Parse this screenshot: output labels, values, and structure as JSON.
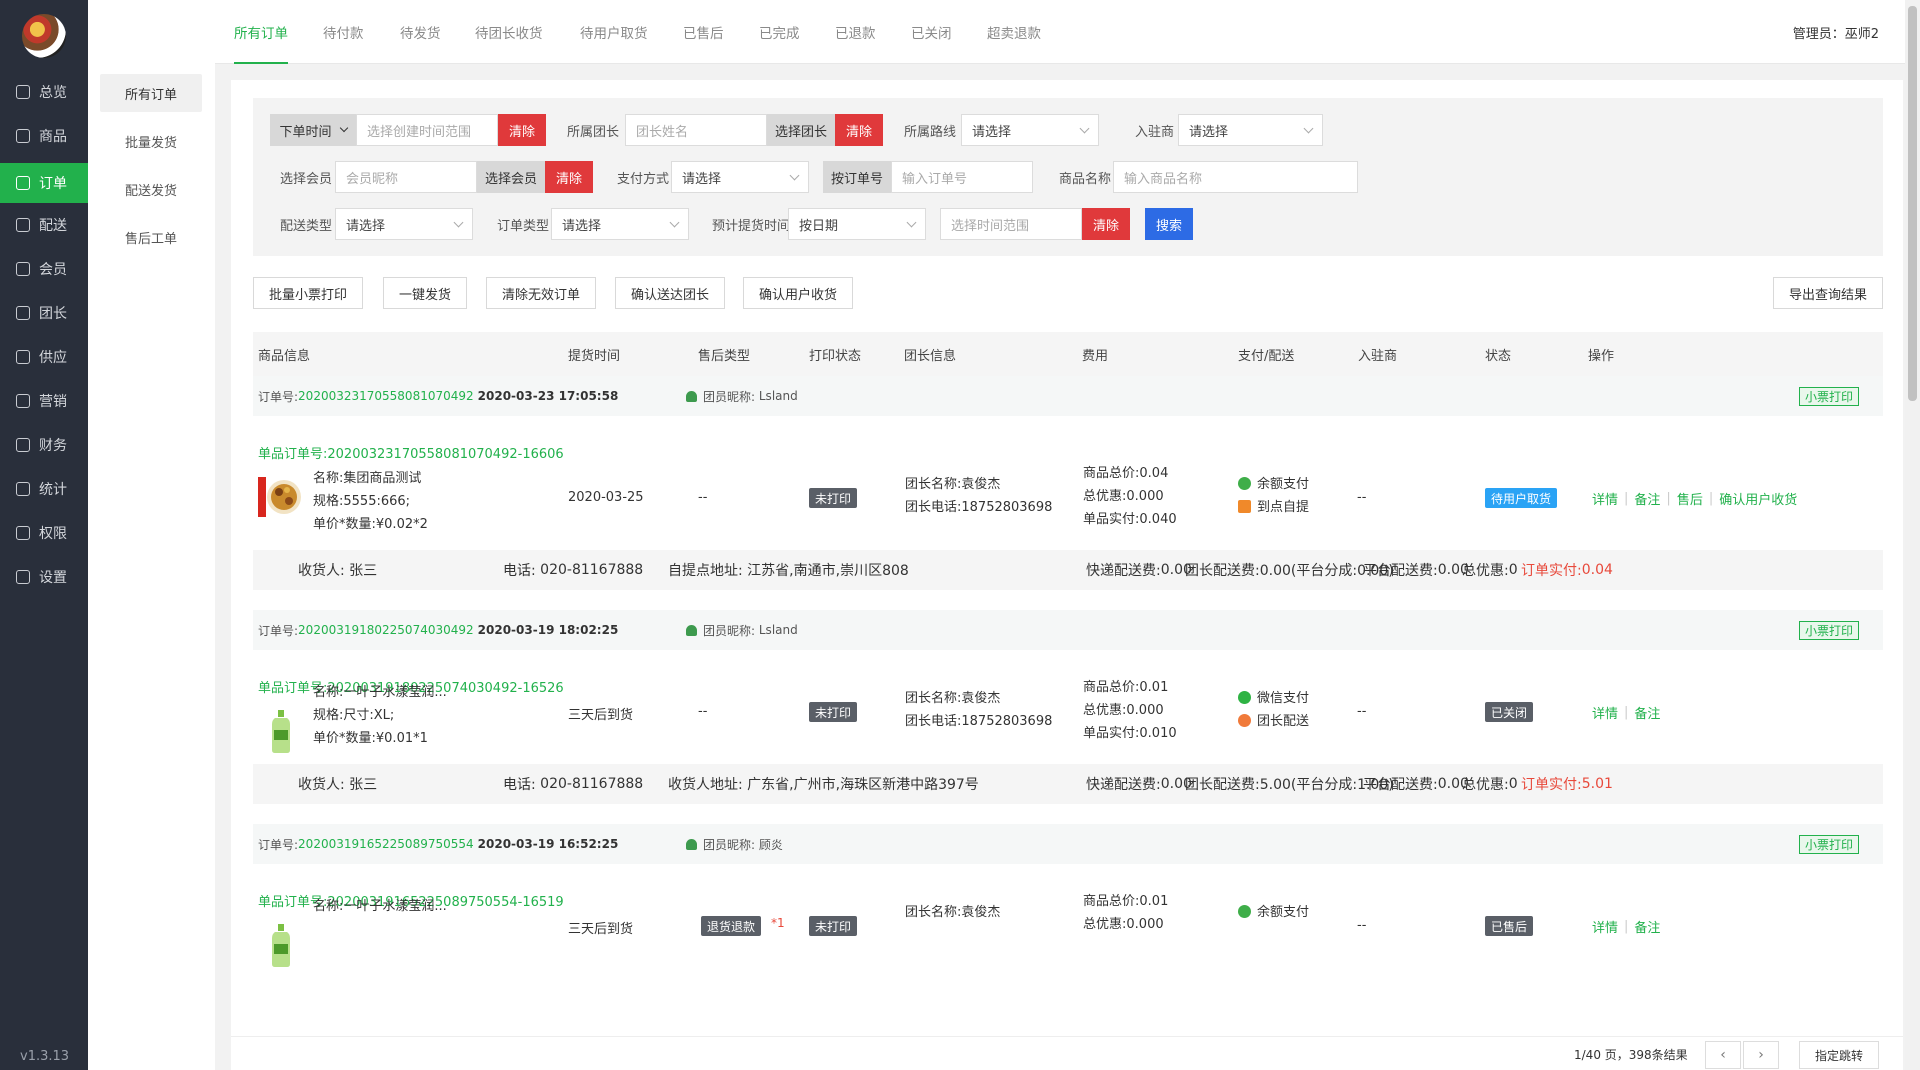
{
  "sidebar": {
    "version": "v1.3.13",
    "items": [
      {
        "label": "总览",
        "icon": "home-icon"
      },
      {
        "label": "商品",
        "icon": "box-icon"
      },
      {
        "label": "订单",
        "icon": "order-icon"
      },
      {
        "label": "配送",
        "icon": "truck-icon"
      },
      {
        "label": "会员",
        "icon": "user-icon"
      },
      {
        "label": "团长",
        "icon": "team-icon"
      },
      {
        "label": "供应",
        "icon": "supply-icon"
      },
      {
        "label": "营销",
        "icon": "gift-icon"
      },
      {
        "label": "财务",
        "icon": "finance-icon"
      },
      {
        "label": "统计",
        "icon": "chart-icon"
      },
      {
        "label": "权限",
        "icon": "shield-icon"
      },
      {
        "label": "设置",
        "icon": "gear-icon"
      }
    ]
  },
  "subnav": [
    "所有订单",
    "批量发货",
    "配送发货",
    "售后工单"
  ],
  "tabs": [
    "所有订单",
    "待付款",
    "待发货",
    "待团长收货",
    "待用户取货",
    "已售后",
    "已完成",
    "已退款",
    "已关闭",
    "超卖退款"
  ],
  "admin": {
    "label": "管理员：",
    "name": "巫师2"
  },
  "filters": {
    "order_time": "下单时间",
    "order_time_placeholder": "选择创建时间范围",
    "clear": "清除",
    "leader_label": "所属团长",
    "leader_placeholder": "团长姓名",
    "choose_leader": "选择团长",
    "route_label": "所属路线",
    "route_value": "请选择",
    "merchant_label": "入驻商",
    "merchant_value": "请选择",
    "member_label": "选择会员",
    "member_placeholder": "会员昵称",
    "choose_member": "选择会员",
    "pay_label": "支付方式",
    "pay_value": "请选择",
    "order_no_btn": "按订单号",
    "order_no_placeholder": "输入订单号",
    "goods_label": "商品名称",
    "goods_placeholder": "输入商品名称",
    "delivery_label": "配送类型",
    "delivery_value": "请选择",
    "ordertype_label": "订单类型",
    "ordertype_value": "请选择",
    "pickup_label": "预计提货时间",
    "pickup_value": "按日期",
    "pickup_placeholder": "选择时间范围",
    "search": "搜索"
  },
  "actions": [
    "批量小票打印",
    "一键发货",
    "清除无效订单",
    "确认送达团长",
    "确认用户收货"
  ],
  "export": "导出查询结果",
  "columns": [
    "商品信息",
    "提货时间",
    "售后类型",
    "打印状态",
    "团长信息",
    "费用",
    "支付/配送",
    "入驻商",
    "状态",
    "操作"
  ],
  "labels": {
    "order_no": "订单号:",
    "member": "团员昵称:",
    "ticket": "小票打印",
    "sub_order": "单品订单号:",
    "name": "名称:",
    "spec": "规格:",
    "unit": "单价*数量:",
    "leader_name": "团长名称:",
    "leader_phone": "团长电话:",
    "goods_total": "商品总价:",
    "total_discount": "总优惠:",
    "goods_paid": "单品实付:",
    "receiver": "收货人:",
    "phone": "电话:",
    "express_fee": "快递配送费:",
    "leader_fee": "团长配送费:",
    "platform_fee": "平台配送费:",
    "discount_total": "总优惠:",
    "order_paid": "订单实付:"
  },
  "orders": [
    {
      "order_no": "20200323170558081070492",
      "datetime": "2020-03-23 17:05:58",
      "member": "Lsland",
      "sub_no": "20200323170558081070492-16606",
      "name": "集团商品测试",
      "spec": "5555:666;",
      "unit": "¥0.02*2",
      "pickup": "2020-03-25",
      "aftersale": "--",
      "aftersale_badge": "",
      "aftersale_count": "",
      "print": "未打印",
      "leader_name": "袁俊杰",
      "leader_phone": "18752803698",
      "goods_total": "0.04",
      "discount": "0.000",
      "goods_paid": "0.040",
      "pay": "余额支付",
      "delivery": "到点自提",
      "merchant": "--",
      "status": "待用户取货",
      "status_style": "blue",
      "ops": [
        "详情",
        "备注",
        "售后",
        "确认用户收货"
      ],
      "receiver": "张三",
      "phone": "020-81167888",
      "address_label": "自提点地址:",
      "address": "江苏省,南通市,崇川区808",
      "express_fee": "0.00",
      "leader_fee": "0.00(平台分成:0.00)",
      "platform_fee": "0.00",
      "discount_total": "0",
      "order_paid": "0.04",
      "thumb": "food"
    },
    {
      "order_no": "20200319180225074030492",
      "datetime": "2020-03-19 18:02:25",
      "member": "Lsland",
      "sub_no": "20200319180225074030492-16526",
      "name": "一叶子水漾莹润...",
      "spec": "尺寸:XL;",
      "unit": "¥0.01*1",
      "pickup": "三天后到货",
      "aftersale": "--",
      "aftersale_badge": "",
      "aftersale_count": "",
      "print": "未打印",
      "leader_name": "袁俊杰",
      "leader_phone": "18752803698",
      "goods_total": "0.01",
      "discount": "0.000",
      "goods_paid": "0.010",
      "pay": "微信支付",
      "delivery": "团长配送",
      "merchant": "--",
      "status": "已关闭",
      "status_style": "dark",
      "ops": [
        "详情",
        "备注"
      ],
      "receiver": "张三",
      "phone": "020-81167888",
      "address_label": "收货人地址:",
      "address": "广东省,广州市,海珠区新港中路397号",
      "express_fee": "0.00",
      "leader_fee": "5.00(平台分成:1.00)",
      "platform_fee": "0.00",
      "discount_total": "0",
      "order_paid": "5.01",
      "thumb": "bottle"
    },
    {
      "order_no": "20200319165225089750554",
      "datetime": "2020-03-19 16:52:25",
      "member": "顾炎",
      "sub_no": "20200319165225089750554-16519",
      "name": "一叶子水漾莹润...",
      "spec": "",
      "unit": "",
      "pickup": "三天后到货",
      "aftersale": "",
      "aftersale_badge": "退货退款",
      "aftersale_count": "*1",
      "print": "未打印",
      "leader_name": "袁俊杰",
      "leader_phone": "",
      "goods_total": "0.01",
      "discount": "0.000",
      "goods_paid": "",
      "pay": "余额支付",
      "delivery": "",
      "merchant": "--",
      "status": "已售后",
      "status_style": "dark",
      "ops": [
        "详情",
        "备注"
      ],
      "thumb": "bottle"
    }
  ],
  "pager": {
    "info": "1/40 页，398条结果",
    "prev": "‹",
    "next": "›",
    "jump": "指定跳转"
  },
  "colors": {
    "accent": "#22b14c",
    "danger": "#e0393b",
    "primary": "#2d6be5",
    "sidebar_bg": "#292f3b"
  }
}
